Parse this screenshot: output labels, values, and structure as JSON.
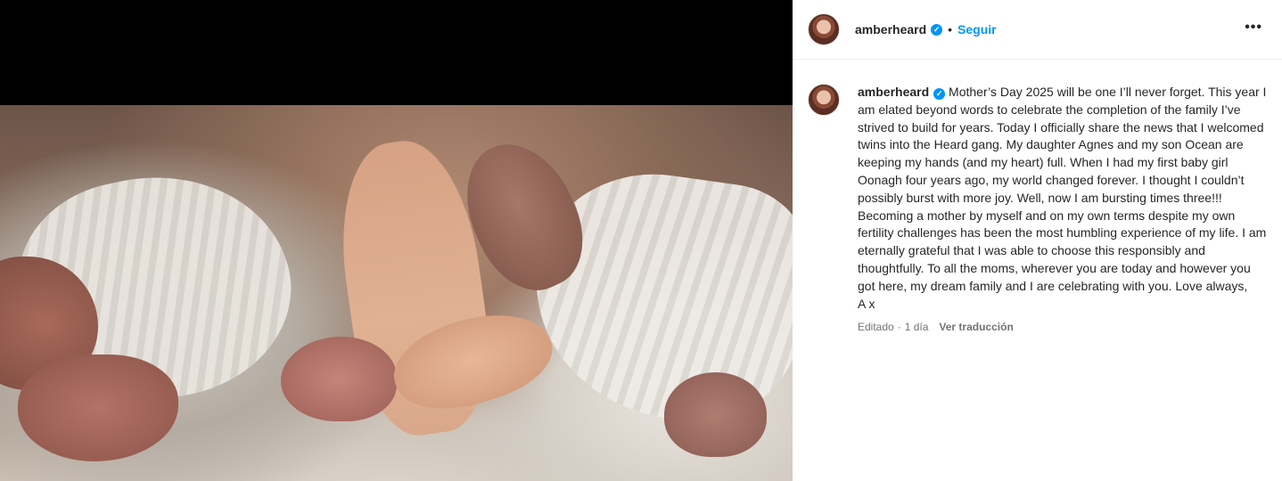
{
  "post": {
    "username": "amberheard",
    "follow_label": "Seguir",
    "separator": "•",
    "more_icon": "more-horizontal-icon",
    "verified_icon": "verified-badge-icon"
  },
  "caption": {
    "username": "amberheard",
    "text": "Mother’s Day 2025 will be one I’ll never forget. This year I am elated beyond words to celebrate the completion of the family I’ve strived to build for years. Today I officially share the news that I welcomed twins into the Heard gang. My daughter Agnes and my son Ocean are keeping my hands (and my heart) full. When I had my first baby girl Oonagh four years ago, my world changed forever. I thought I couldn’t possibly burst with more joy. Well, now I am bursting times three!!! Becoming a mother by myself and on my own terms despite my own fertility challenges has been the most humbling experience of my life. I am eternally grateful that I was able to choose this responsibly and thoughtfully. To all the moms, wherever you are today and however you got here, my dream family and I are celebrating with you. Love always,\nA x",
    "edited_label": "Editado",
    "meta_sep": "·",
    "time_ago": "1 día",
    "translate_label": "Ver traducción"
  },
  "colors": {
    "link_blue": "#0095f6",
    "text": "#262626",
    "secondary_text": "#737373"
  }
}
